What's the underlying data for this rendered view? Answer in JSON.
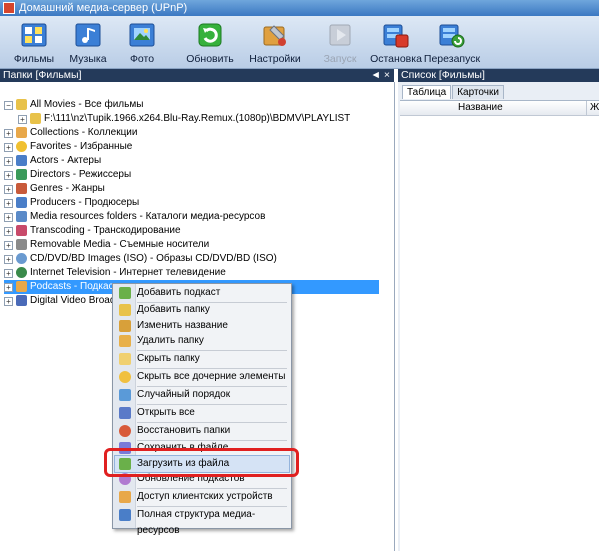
{
  "window": {
    "title": "Домашний медиа-сервер (UPnP)"
  },
  "toolbar": {
    "buttons": [
      {
        "label": "Фильмы",
        "icon": "film-icon",
        "color": "#2f74d0"
      },
      {
        "label": "Музыка",
        "icon": "music-icon",
        "color": "#2f74d0"
      },
      {
        "label": "Фото",
        "icon": "photo-icon",
        "color": "#2f74d0"
      },
      {
        "label": "Обновить",
        "icon": "refresh-icon",
        "color": "#2fa32f"
      },
      {
        "label": "Настройки",
        "icon": "settings-icon",
        "color": "#d08a2a"
      },
      {
        "label": "Запуск",
        "icon": "start-icon",
        "color": "#b8c0cc"
      },
      {
        "label": "Остановка",
        "icon": "stop-icon",
        "color": "#c83a2a"
      },
      {
        "label": "Перезапуск",
        "icon": "restart-icon",
        "color": "#3a78c8"
      }
    ]
  },
  "left_panel": {
    "header": "Папки [Фильмы]",
    "header_icons": "◄ ×"
  },
  "right_panel": {
    "header": "Список [Фильмы]",
    "tabs": [
      "Таблица",
      "Карточки"
    ],
    "columns": [
      "Название",
      "Жанр"
    ]
  },
  "tree": [
    {
      "label": "All Movies - Все фильмы",
      "expander": "−",
      "icon_color": "#e8c24a"
    },
    {
      "label": "F:\\111\\nz\\Tupik.1966.x264.Blu-Ray.Remux.(1080p)\\BDMV\\PLAYLIST",
      "expander": "+",
      "icon_color": "#e8c24a"
    },
    {
      "label": "Collections - Коллекции",
      "expander": "+",
      "icon_color": "#e8a84a"
    },
    {
      "label": "Favorites - Избранные",
      "expander": "+",
      "icon_color": "#f0c030"
    },
    {
      "label": "Actors - Актеры",
      "expander": "+",
      "icon_color": "#4a7ec8"
    },
    {
      "label": "Directors - Режиссеры",
      "expander": "+",
      "icon_color": "#3a9a5a"
    },
    {
      "label": "Genres - Жанры",
      "expander": "+",
      "icon_color": "#c85a3a"
    },
    {
      "label": "Producers - Продюсеры",
      "expander": "+",
      "icon_color": "#4a7ec8"
    },
    {
      "label": "Media resources folders - Каталоги медиа-ресурсов",
      "expander": "+",
      "icon_color": "#5a8ac8"
    },
    {
      "label": "Transcoding - Транскодирование",
      "expander": "+",
      "icon_color": "#c84a6a"
    },
    {
      "label": "Removable Media - Съемные носители",
      "expander": "+",
      "icon_color": "#8a8a8a"
    },
    {
      "label": "CD/DVD/BD Images (ISO) - Образы CD/DVD/BD (ISO)",
      "expander": "+",
      "icon_color": "#6a9ad0"
    },
    {
      "label": "Internet Television - Интернет телевидение",
      "expander": "+",
      "icon_color": "#3a8a4a"
    },
    {
      "label": "Podcasts - Подкасты",
      "expander": "+",
      "icon_color": "#e8a84a"
    },
    {
      "label": "Digital Video Broadcasting",
      "expander": "+",
      "icon_color": "#4a6ab8"
    }
  ],
  "context_menu": {
    "items": [
      {
        "label": "Добавить подкаст",
        "icon_color": "#6ab04a"
      },
      {
        "label": "Добавить папку",
        "icon_color": "#e8c24a"
      },
      {
        "label": "Изменить название",
        "icon_color": "#d8a03a"
      },
      {
        "label": "Удалить папку",
        "icon_color": "#e8b04a"
      },
      {
        "label": "Скрыть папку",
        "icon_color": "#f0d070"
      },
      {
        "label": "Скрыть все дочерние элементы",
        "icon_color": "#f0c040"
      },
      {
        "label": "Случайный порядок",
        "icon_color": "#5a9ad8"
      },
      {
        "label": "Открыть все",
        "icon_color": "#5a7ac8"
      },
      {
        "label": "Восстановить папки",
        "icon_color": "#d85a3a"
      },
      {
        "label": "Сохранить в файле",
        "icon_color": "#7a7ad8"
      },
      {
        "label": "Загрузить из файла",
        "icon_color": "#6ab04a"
      },
      {
        "label": "Обновление подкастов",
        "icon_color": "#b07ad0"
      },
      {
        "label": "Доступ клиентских устройств",
        "icon_color": "#e8a84a"
      },
      {
        "label": "Полная структура медиа-ресурсов",
        "icon_color": "#4a7ec8"
      }
    ]
  }
}
